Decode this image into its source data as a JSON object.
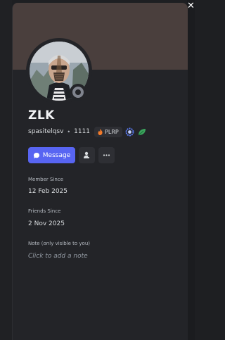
{
  "window": {
    "close_glyph": "✕"
  },
  "profile": {
    "display_name": "ZLK",
    "username": "spasitelqsv",
    "discriminator_dot": "•",
    "discriminator": "1111",
    "server_tag": "PLRP",
    "status": "offline",
    "avatar": "avatar-photo",
    "badges": [
      "hypesquad-icon",
      "leaf-icon"
    ]
  },
  "actions": {
    "message_label": "Message",
    "add_friend_icon": "user-add-icon",
    "more_icon": "ellipsis-icon"
  },
  "member_since": {
    "label": "Member Since",
    "value": "12 Feb 2025"
  },
  "friends_since": {
    "label": "Friends Since",
    "value": "2 Nov 2025"
  },
  "note": {
    "label": "Note (only visible to you)",
    "placeholder": "Click to add a note"
  },
  "colors": {
    "banner": "#4a3f3d",
    "card": "#232428",
    "accent": "#5865f2",
    "status_offline": "#80848e"
  }
}
